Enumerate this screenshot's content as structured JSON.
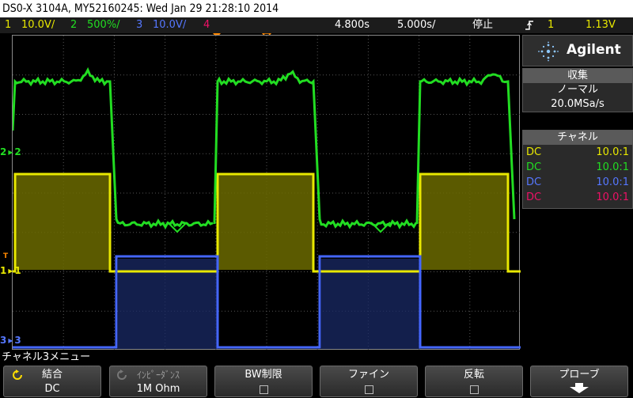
{
  "title": "DS0-X 3104A, MY52160245: Wed Jan 29 21:28:10 2014",
  "status": {
    "ch1_num": "1",
    "ch1_scale": "10.0V/",
    "ch2_num": "2",
    "ch2_scale": "500%/",
    "ch3_num": "3",
    "ch3_scale": "10.0V/",
    "ch4_num": "4",
    "delay": "4.800s",
    "timebase": "5.000s/",
    "run_state": "停止",
    "trigger_icon": "trigger-edge-icon",
    "trigger_ch": "1",
    "trigger_level": "1.13V"
  },
  "side": {
    "logo_text": "Agilent",
    "acq_head": "収集",
    "acq_mode": "ノーマル",
    "acq_rate": "20.0MSa/s",
    "chan_head": "チャネル",
    "channels": [
      {
        "coupling": "DC",
        "probe": "10.0:1",
        "color": "#e8e800"
      },
      {
        "coupling": "DC",
        "probe": "10.0:1",
        "color": "#22dd22"
      },
      {
        "coupling": "DC",
        "probe": "10.0:1",
        "color": "#5577ff"
      },
      {
        "coupling": "DC",
        "probe": "10.0:1",
        "color": "#ee1166"
      }
    ]
  },
  "markers": {
    "ch2": "2",
    "ch2b": "2",
    "ch1": "1",
    "ch1b": "1",
    "ch3": "3",
    "ch3b": "3",
    "t": "T"
  },
  "menu_title": "チャネル3メニュー",
  "softkeys": [
    {
      "label": "結合",
      "value": "DC"
    },
    {
      "label": "ｲﾝﾋﾟｰﾀﾞﾝｽ",
      "value": "1M Ohm"
    },
    {
      "label": "BW制限",
      "value": ""
    },
    {
      "label": "ファイン",
      "value": ""
    },
    {
      "label": "反転",
      "value": ""
    },
    {
      "label": "プローブ",
      "value": ""
    }
  ],
  "colors": {
    "ch1": "#e8e800",
    "ch2": "#22dd22",
    "ch3": "#4466ff",
    "ch4": "#ee1166",
    "orange": "#ff8800"
  }
}
